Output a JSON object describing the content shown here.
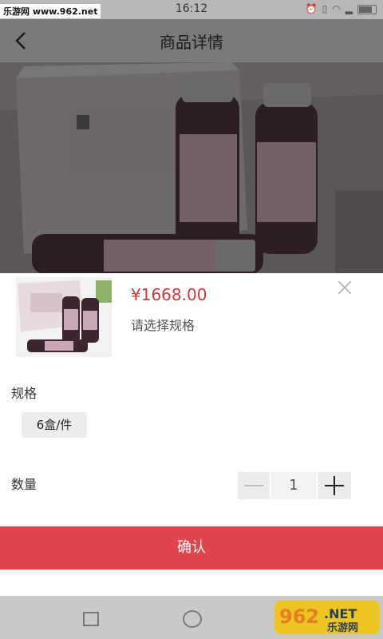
{
  "status_bar": {
    "watermark": "乐游网 www.962.net",
    "time": "16:12",
    "icons": [
      "alarm-icon",
      "vibrate-icon",
      "wifi-icon",
      "signal-icon",
      "battery-icon"
    ]
  },
  "header": {
    "back_icon": "back-chevron-icon",
    "title": "商品详情"
  },
  "product": {
    "price": "¥1668.00",
    "select_hint": "请选择规格"
  },
  "spec": {
    "label": "规格",
    "options": [
      "6盒/件"
    ]
  },
  "quantity": {
    "label": "数量",
    "value": "1"
  },
  "actions": {
    "confirm": "确认"
  },
  "nav_bar": {
    "icons": [
      "recent-apps-icon",
      "home-icon"
    ]
  },
  "watermark_br": {
    "brand": "962",
    "tld": ".NET",
    "site": "乐游网"
  },
  "colors": {
    "accent": "#e0454b",
    "price": "#d03939"
  }
}
